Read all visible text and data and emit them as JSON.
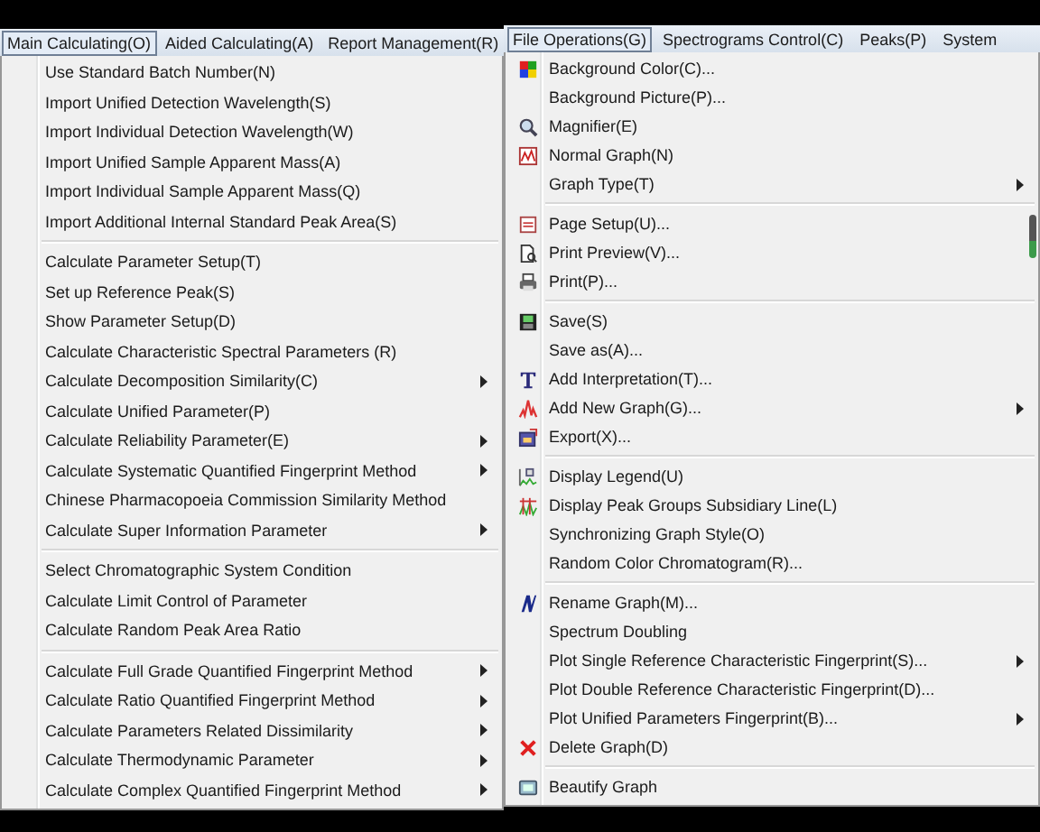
{
  "panels": [
    {
      "menubar": [
        {
          "label": "Main Calculating(O)",
          "selected": true
        },
        {
          "label": "Aided Calculating(A)",
          "selected": false
        },
        {
          "label": "Report Management(R)",
          "selected": false
        }
      ],
      "menu": [
        {
          "kind": "item",
          "label": "Use Standard Batch Number(N)",
          "submenu": false
        },
        {
          "kind": "item",
          "label": "Import Unified Detection Wavelength(S)",
          "submenu": false
        },
        {
          "kind": "item",
          "label": "Import Individual Detection Wavelength(W)",
          "submenu": false
        },
        {
          "kind": "item",
          "label": "Import Unified Sample Apparent Mass(A)",
          "submenu": false
        },
        {
          "kind": "item",
          "label": "Import Individual Sample Apparent Mass(Q)",
          "submenu": false
        },
        {
          "kind": "item",
          "label": "Import Additional Internal Standard Peak Area(S)",
          "submenu": false
        },
        {
          "kind": "separator"
        },
        {
          "kind": "item",
          "label": "Calculate Parameter Setup(T)",
          "submenu": false
        },
        {
          "kind": "item",
          "label": "Set up Reference Peak(S)",
          "submenu": false
        },
        {
          "kind": "item",
          "label": "Show Parameter Setup(D)",
          "submenu": false
        },
        {
          "kind": "item",
          "label": "Calculate Characteristic Spectral Parameters (R)",
          "submenu": false
        },
        {
          "kind": "item",
          "label": "Calculate Decomposition Similarity(C)",
          "submenu": true
        },
        {
          "kind": "item",
          "label": "Calculate Unified Parameter(P)",
          "submenu": false
        },
        {
          "kind": "item",
          "label": "Calculate Reliability Parameter(E)",
          "submenu": true
        },
        {
          "kind": "item",
          "label": "Calculate Systematic Quantified Fingerprint Method",
          "submenu": true
        },
        {
          "kind": "item",
          "label": "Chinese Pharmacopoeia Commission Similarity Method",
          "submenu": false
        },
        {
          "kind": "item",
          "label": "Calculate Super Information Parameter",
          "submenu": true
        },
        {
          "kind": "separator"
        },
        {
          "kind": "item",
          "label": "Select  Chromatographic System Condition",
          "submenu": false
        },
        {
          "kind": "item",
          "label": "Calculate Limit Control of Parameter",
          "submenu": false
        },
        {
          "kind": "item",
          "label": "Calculate Random Peak Area Ratio",
          "submenu": false
        },
        {
          "kind": "separator"
        },
        {
          "kind": "item",
          "label": "Calculate Full Grade Quantified Fingerprint Method",
          "submenu": true
        },
        {
          "kind": "item",
          "label": "Calculate Ratio Quantified Fingerprint Method",
          "submenu": true
        },
        {
          "kind": "item",
          "label": "Calculate Parameters Related Dissimilarity",
          "submenu": true
        },
        {
          "kind": "item",
          "label": "Calculate Thermodynamic Parameter",
          "submenu": true
        },
        {
          "kind": "item",
          "label": "Calculate Complex Quantified Fingerprint Method",
          "submenu": true
        }
      ]
    },
    {
      "menubar": [
        {
          "label": "File Operations(G)",
          "selected": true
        },
        {
          "label": "Spectrograms  Control(C)",
          "selected": false
        },
        {
          "label": "Peaks(P)",
          "selected": false
        },
        {
          "label": "System",
          "selected": false
        }
      ],
      "menu": [
        {
          "kind": "item",
          "label": "Background Color(C)...",
          "submenu": false
        },
        {
          "kind": "item",
          "label": "Background Picture(P)...",
          "submenu": false
        },
        {
          "kind": "item",
          "label": "Magnifier(E)",
          "submenu": false
        },
        {
          "kind": "item",
          "label": "Normal Graph(N)",
          "submenu": false
        },
        {
          "kind": "item",
          "label": "Graph Type(T)",
          "submenu": true
        },
        {
          "kind": "separator"
        },
        {
          "kind": "item",
          "label": "Page Setup(U)...",
          "submenu": false
        },
        {
          "kind": "item",
          "label": "Print Preview(V)...",
          "submenu": false
        },
        {
          "kind": "item",
          "label": "Print(P)...",
          "submenu": false
        },
        {
          "kind": "separator"
        },
        {
          "kind": "item",
          "label": "Save(S)",
          "submenu": false
        },
        {
          "kind": "item",
          "label": "Save as(A)...",
          "submenu": false
        },
        {
          "kind": "item",
          "label": "Add Interpretation(T)...",
          "submenu": false
        },
        {
          "kind": "item",
          "label": "Add New Graph(G)...",
          "submenu": true
        },
        {
          "kind": "item",
          "label": "Export(X)...",
          "submenu": false
        },
        {
          "kind": "separator"
        },
        {
          "kind": "item",
          "label": "Display Legend(U)",
          "submenu": false
        },
        {
          "kind": "item",
          "label": "Display Peak Groups Subsidiary Line(L)",
          "submenu": false
        },
        {
          "kind": "item",
          "label": "Synchronizing Graph Style(O)",
          "submenu": false
        },
        {
          "kind": "item",
          "label": "Random Color Chromatogram(R)...",
          "submenu": false
        },
        {
          "kind": "separator"
        },
        {
          "kind": "item",
          "label": "Rename Graph(M)...",
          "submenu": false
        },
        {
          "kind": "item",
          "label": "Spectrum Doubling",
          "submenu": false
        },
        {
          "kind": "item",
          "label": "Plot Single Reference Characteristic Fingerprint(S)...",
          "submenu": true
        },
        {
          "kind": "item",
          "label": "Plot Double Reference Characteristic Fingerprint(D)...",
          "submenu": false
        },
        {
          "kind": "item",
          "label": "Plot Unified Parameters Fingerprint(B)...",
          "submenu": true
        },
        {
          "kind": "item",
          "label": "Delete Graph(D)",
          "submenu": false
        },
        {
          "kind": "separator"
        },
        {
          "kind": "item",
          "label": "Beautify Graph",
          "submenu": false
        }
      ]
    }
  ]
}
